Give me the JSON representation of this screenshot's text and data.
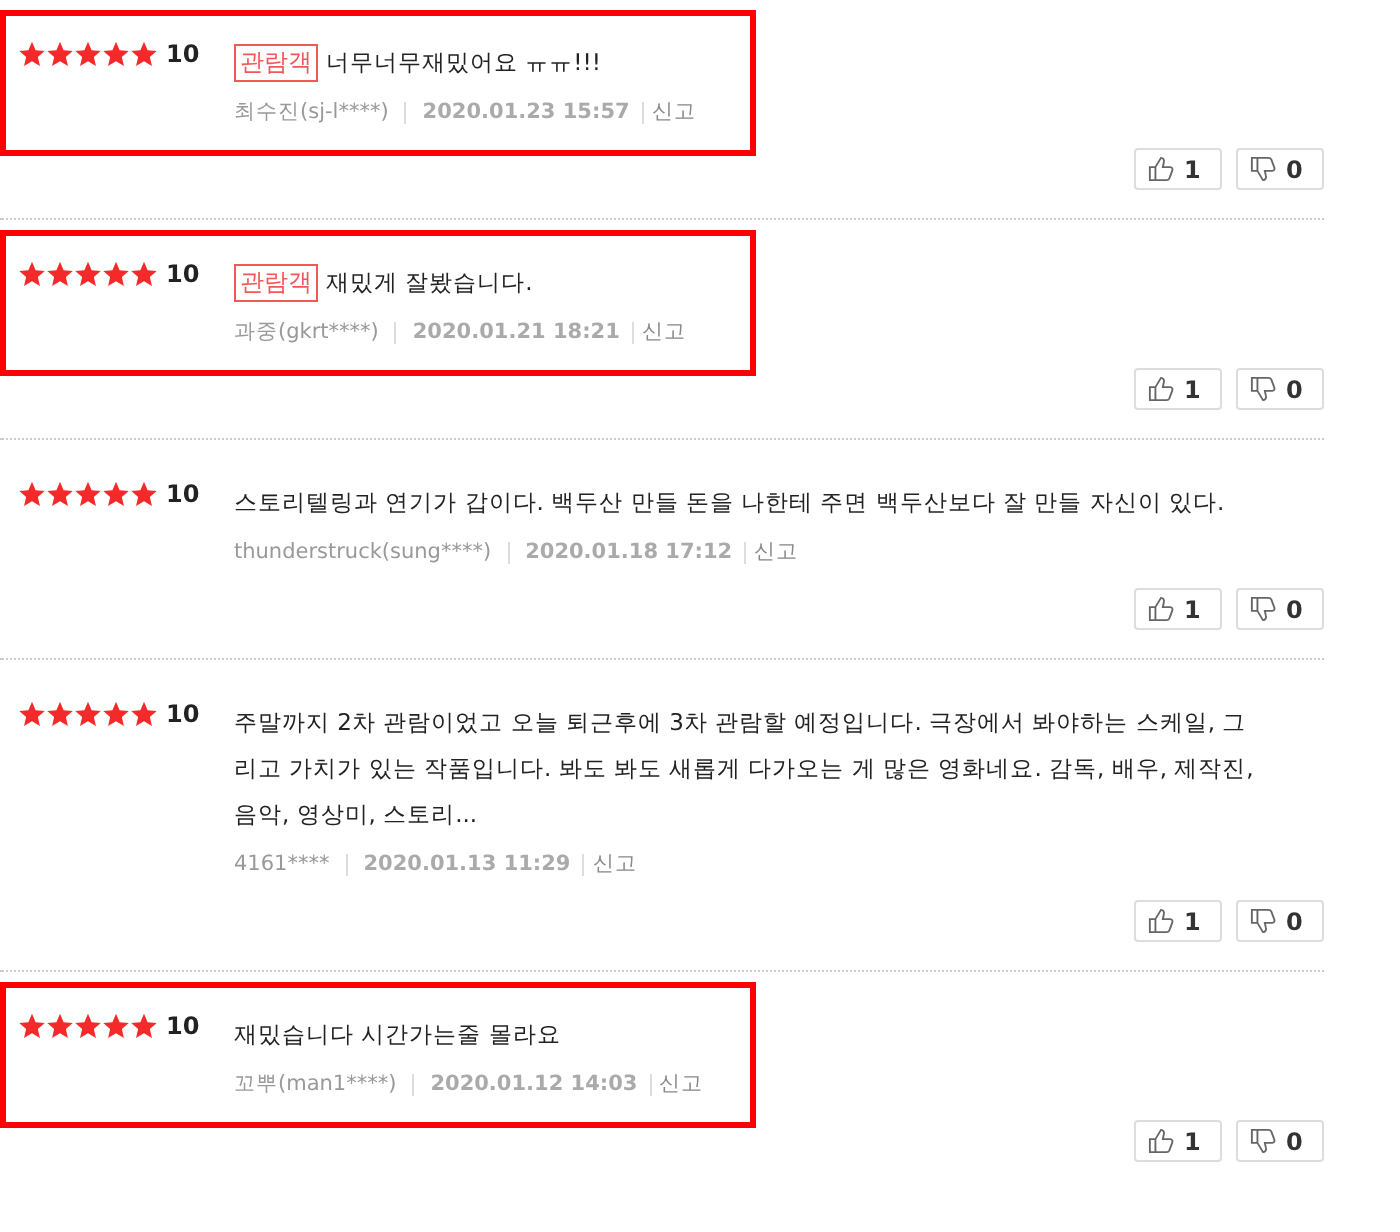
{
  "reviews": [
    {
      "stars": 5,
      "score": "10",
      "badge": "관람객",
      "text": "너무너무재밌어요 ㅠㅠ!!!",
      "author": "최수진(sj-l****)",
      "date": "2020.01.23 15:57",
      "report": "신고",
      "likes": "1",
      "dislikes": "0",
      "highlighted": true
    },
    {
      "stars": 5,
      "score": "10",
      "badge": "관람객",
      "text": "재밌게 잘봤습니다.",
      "author": "과중(gkrt****)",
      "date": "2020.01.21 18:21",
      "report": "신고",
      "likes": "1",
      "dislikes": "0",
      "highlighted": true
    },
    {
      "stars": 5,
      "score": "10",
      "text": "스토리텔링과 연기가 갑이다. 백두산 만들 돈을 나한테 주면 백두산보다 잘 만들 자신이 있다.",
      "author": "thunderstruck(sung****)",
      "date": "2020.01.18 17:12",
      "report": "신고",
      "likes": "1",
      "dislikes": "0",
      "highlighted": false
    },
    {
      "stars": 5,
      "score": "10",
      "text": "주말까지 2차 관람이었고 오늘 퇴근후에 3차 관람할 예정입니다. 극장에서 봐야하는 스케일, 그리고 가치가 있는 작품입니다. 봐도 봐도 새롭게 다가오는 게 많은 영화네요. 감독, 배우, 제작진, 음악, 영상미, 스토리...",
      "author": "4161****",
      "date": "2020.01.13 11:29",
      "report": "신고",
      "likes": "1",
      "dislikes": "0",
      "highlighted": false
    },
    {
      "stars": 5,
      "score": "10",
      "text": "재밌습니다 시간가는줄 몰라요",
      "author": "꼬뿌(man1****)",
      "date": "2020.01.12 14:03",
      "report": "신고",
      "likes": "1",
      "dislikes": "0",
      "highlighted": true
    }
  ]
}
